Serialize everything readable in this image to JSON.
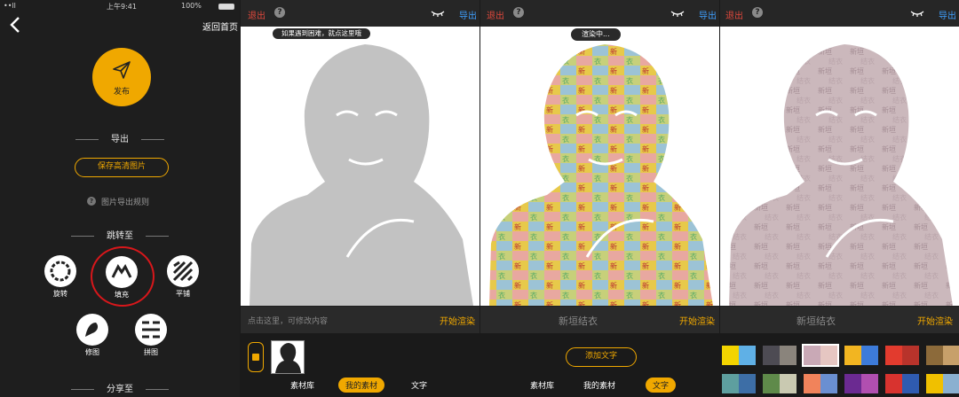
{
  "status_bar": {
    "carrier": "••ll ",
    "time": "上午9:41",
    "battery": "100%"
  },
  "left": {
    "back_label": "返回首页",
    "publish_label": "发布",
    "export_section": "导出",
    "save_hd_label": "保存高清图片",
    "export_rules_label": "图片导出规则",
    "jump_section": "跳转至",
    "jump_items": [
      "旋转",
      "填充",
      "平铺",
      "修图",
      "拼图"
    ],
    "share_section": "分享至"
  },
  "editor1": {
    "exit_label": "退出",
    "export_label": "导出",
    "tooltip": "如果遇到困难，就点这里哦",
    "textbar_hint": "点击这里，可修改内容",
    "start_label": "开始渲染",
    "tabs": [
      "素材库",
      "我的素材",
      "文字"
    ],
    "active_tab": "我的素材"
  },
  "editor2": {
    "exit_label": "退出",
    "export_label": "导出",
    "status_bubble": "渲染中...",
    "textbar_title": "新垣结衣",
    "start_label": "开始渲染",
    "add_text_label": "添加文字",
    "tabs": [
      "素材库",
      "我的素材",
      "文字"
    ],
    "active_tab": "文字"
  },
  "editor3": {
    "exit_label": "退出",
    "export_label": "导出",
    "textbar_title": "新垣结衣",
    "start_label": "开始渲染"
  },
  "palette": [
    [
      "#f3d400",
      "#5fb0e6"
    ],
    [
      "#4d4b53",
      "#8a847c"
    ],
    [
      "#c9a9b6",
      "#e6c6c2"
    ],
    [
      "#f2b521",
      "#3d7bd9"
    ],
    [
      "#e23b2e",
      "#b8332b"
    ],
    [
      "#8c6a3a",
      "#c7a06a"
    ],
    [
      "#5e9f9f",
      "#3d6ea6"
    ],
    [
      "#5f8a4a",
      "#c9c9b1"
    ],
    [
      "#f1835b",
      "#6a8fd1"
    ],
    [
      "#6b2a91",
      "#b14fb0"
    ],
    [
      "#d8332f",
      "#2f5bb0"
    ],
    [
      "#f0c000",
      "#8ab0d0"
    ]
  ],
  "colors": {
    "accent": "#f0a800",
    "exit": "#e0483c",
    "export": "#3fa0ff",
    "highlight": "#d8171b"
  }
}
